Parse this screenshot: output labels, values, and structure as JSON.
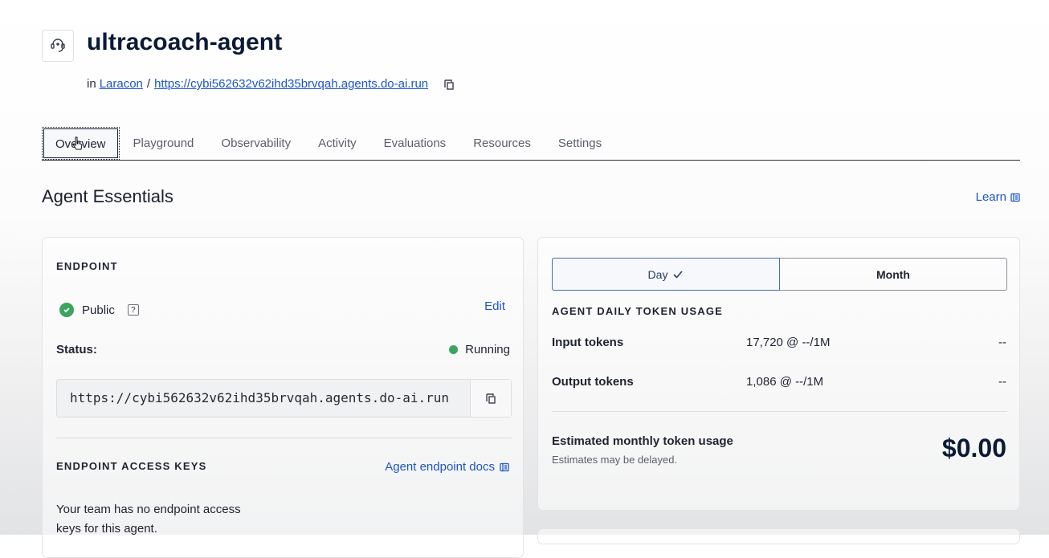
{
  "header": {
    "title": "ultracoach-agent",
    "icon": "agent-icon",
    "breadcrumb": {
      "prefix": "in",
      "workspace": "Laracon",
      "separator": "/",
      "url": "https://cybi562632v62ihd35brvqah.agents.do-ai.run"
    }
  },
  "tabs": [
    {
      "label": "Overview",
      "active": true
    },
    {
      "label": "Playground"
    },
    {
      "label": "Observability"
    },
    {
      "label": "Activity"
    },
    {
      "label": "Evaluations"
    },
    {
      "label": "Resources"
    },
    {
      "label": "Settings"
    }
  ],
  "section": {
    "title": "Agent Essentials",
    "learn_label": "Learn"
  },
  "endpoint": {
    "heading": "ENDPOINT",
    "visibility": "Public",
    "help": "?",
    "edit_label": "Edit",
    "status_label": "Status:",
    "status_value": "Running",
    "url": "https://cybi562632v62ihd35brvqah.agents.do-ai.run",
    "access_keys_heading": "ENDPOINT ACCESS KEYS",
    "docs_label": "Agent endpoint docs",
    "no_keys_line1": "Your team has no endpoint access",
    "no_keys_line2": "keys for this agent."
  },
  "usage": {
    "toggle": {
      "day": "Day",
      "month": "Month",
      "selected": "Day"
    },
    "heading": "AGENT DAILY TOKEN USAGE",
    "rows": [
      {
        "label": "Input tokens",
        "value": "17,720 @ --/1M",
        "cost": "--"
      },
      {
        "label": "Output tokens",
        "value": "1,086 @ --/1M",
        "cost": "--"
      }
    ],
    "estimate_label": "Estimated monthly token usage",
    "estimate_note": "Estimates may be delayed.",
    "estimate_value": "$0.00"
  },
  "colors": {
    "accent": "#1c55c9",
    "success": "#3ba55d",
    "title": "#0b1a36"
  }
}
